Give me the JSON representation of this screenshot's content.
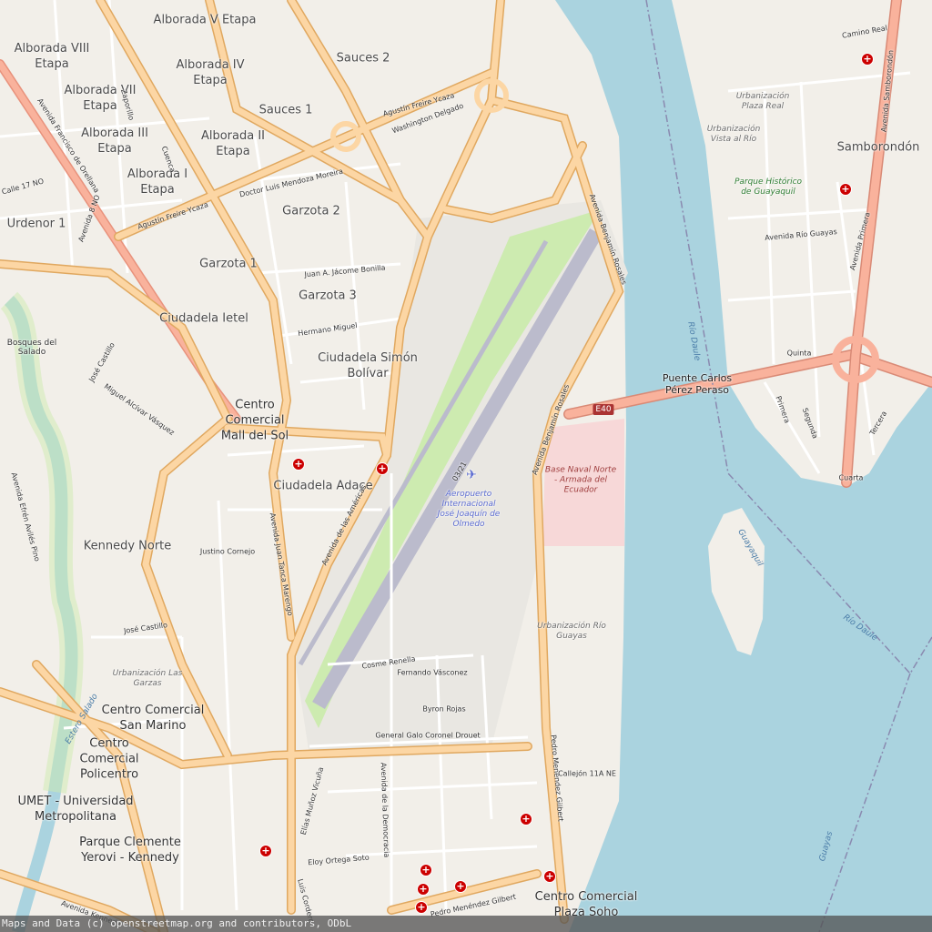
{
  "colors": {
    "water": "#aad3df",
    "land": "#f2efe9",
    "primary_road": "#fcd6a4",
    "trunk_road": "#f9b29c",
    "runway": "#bbbbcc",
    "airport_grass": "#cdebb0",
    "naval": "#f7d8d8"
  },
  "neighborhoods": [
    "Alborada V Etapa",
    "Alborada VIII Etapa",
    "Alborada IV Etapa",
    "Alborada VII Etapa",
    "Alborada III Etapa",
    "Alborada II Etapa",
    "Alborada I Etapa",
    "Sauces 2",
    "Sauces 1",
    "Garzota 2",
    "Garzota 1",
    "Garzota 3",
    "Urdenor 1",
    "Ciudadela Ietel",
    "Ciudadela Simón Bolívar",
    "Ciudadela Adace",
    "Kennedy Norte",
    "Bosques del Salado",
    "Samborondón",
    "Centro Comercial Mall del Sol",
    "Centro Comercial San Marino",
    "Centro Comercial Policentro",
    "UMET - Universidad Metropolitana",
    "Parque Clemente Yerovi - Kennedy",
    "Centro Comercial Plaza Soho",
    "Puente Carlos Pérez Peraso"
  ],
  "streets": [
    "Avenida Francisco de Orellana",
    "Agustín Freire Ycaza",
    "Agustín Freire Ycaza",
    "Avenida Benjamín Rosales",
    "Avenida Benjamín Rosales",
    "Avenida de las Américas",
    "Avenida Juan Tanca Marengo",
    "Pedro Menéndez Gilbert",
    "Pedro Menéndez Gilbert",
    "Avenida Samborondón",
    "Washington Delgado",
    "Doctor Luis Mendoza Moreira",
    "Juan A. Jácome Bonilla",
    "Hermano Miguel",
    "José Castillo",
    "José Castillo",
    "Miguel Alcívar Vásquez",
    "Justino Cornejo",
    "Cosme Renella",
    "Fernando Vásconez",
    "Byron Rojas",
    "Elías Muñoz Vicuña",
    "Eloy Ortega Soto",
    "General Galo Coronel Drouet",
    "Avenida de la Democracia",
    "Avenida Río Guayas",
    "Avenida Primera",
    "Quinta",
    "Primera",
    "Segunda",
    "Tercera",
    "Cuarta",
    "Camino Real",
    "Avenida Kennedy",
    "Callejón 11A NE",
    "Avenida Efrén Avilés Pino",
    "Zaporillo",
    "Cuenca",
    "Avenida 8 NO",
    "Calle 17 NO",
    "Luis Cordero"
  ],
  "italic_labels": [
    "Urbanización Plaza Real",
    "Urbanización Vista al Río",
    "Parque Histórico de Guayaquil",
    "Urbanización Río Guayas",
    "Urbanización Las Garzas"
  ],
  "water_labels": [
    "Río Daule",
    "Río Daule",
    "Guayaquil",
    "Estero Salado",
    "Guayas"
  ],
  "naval_base": "Base Naval Norte - Armada del Ecuador",
  "airport": {
    "name": "Aeropuerto Internacional José Joaquín de Olmedo",
    "runway": "03/21"
  },
  "route_shield": "E40",
  "attribution": "Maps and Data (c) openstreetmap.org and contributors, ODbL"
}
